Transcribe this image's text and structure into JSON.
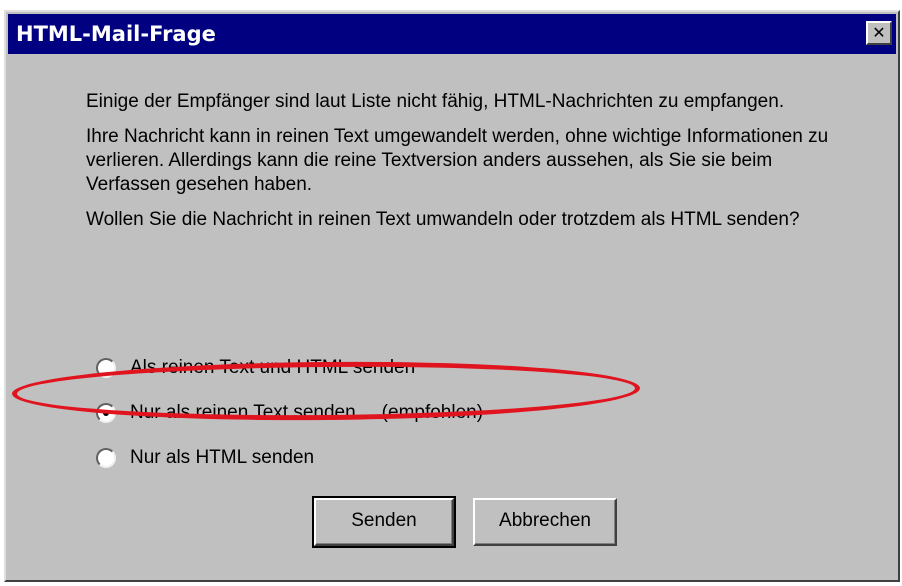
{
  "window": {
    "title": "HTML-Mail-Frage",
    "close_glyph": "✕"
  },
  "message": {
    "paragraph1": "Einige der Empfänger sind laut Liste nicht fähig, HTML-Nachrichten zu empfangen.",
    "paragraph2": "Ihre Nachricht kann in reinen Text umgewandelt werden, ohne wichtige Informationen zu verlieren. Allerdings kann die reine Textversion anders aussehen, als Sie sie beim Verfassen gesehen haben.",
    "paragraph3": "Wollen Sie die Nachricht in reinen Text umwandeln oder trotzdem als HTML senden?"
  },
  "options": [
    {
      "label": "Als reinen Text und HTML senden",
      "extra": "",
      "checked": false
    },
    {
      "label": "Nur als reinen Text senden",
      "extra": "(empfohlen)",
      "checked": true
    },
    {
      "label": "Nur als HTML senden",
      "extra": "",
      "checked": false
    }
  ],
  "buttons": {
    "send_label": "Senden",
    "cancel_label": "Abbrechen"
  },
  "annotation": {
    "highlight_color": "#e0141e"
  }
}
